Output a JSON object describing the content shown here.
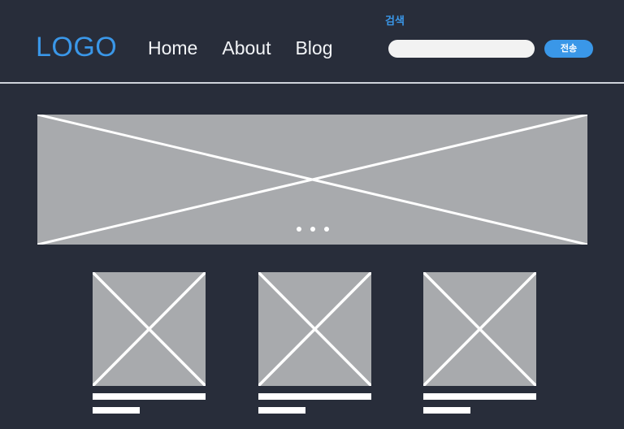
{
  "theme": {
    "background": "#282d3a",
    "accent": "#3a97e8",
    "placeholder_gray": "#a8aaad",
    "line_white": "#ffffff",
    "header_divider": "#cfd3da",
    "input_background": "#f2f2f2"
  },
  "header": {
    "logo": "LOGO",
    "nav": [
      {
        "label": "Home"
      },
      {
        "label": "About"
      },
      {
        "label": "Blog"
      }
    ],
    "search": {
      "label": "검색",
      "value": "",
      "placeholder": "",
      "submit_label": "전송"
    }
  },
  "hero": {
    "name": "hero-image-placeholder",
    "dots": [
      {
        "active": true
      },
      {
        "active": true
      },
      {
        "active": true
      }
    ]
  },
  "cards": [
    {
      "thumb": "image-placeholder",
      "title_bar": "",
      "sub_bar": ""
    },
    {
      "thumb": "image-placeholder",
      "title_bar": "",
      "sub_bar": ""
    },
    {
      "thumb": "image-placeholder",
      "title_bar": "",
      "sub_bar": ""
    }
  ]
}
